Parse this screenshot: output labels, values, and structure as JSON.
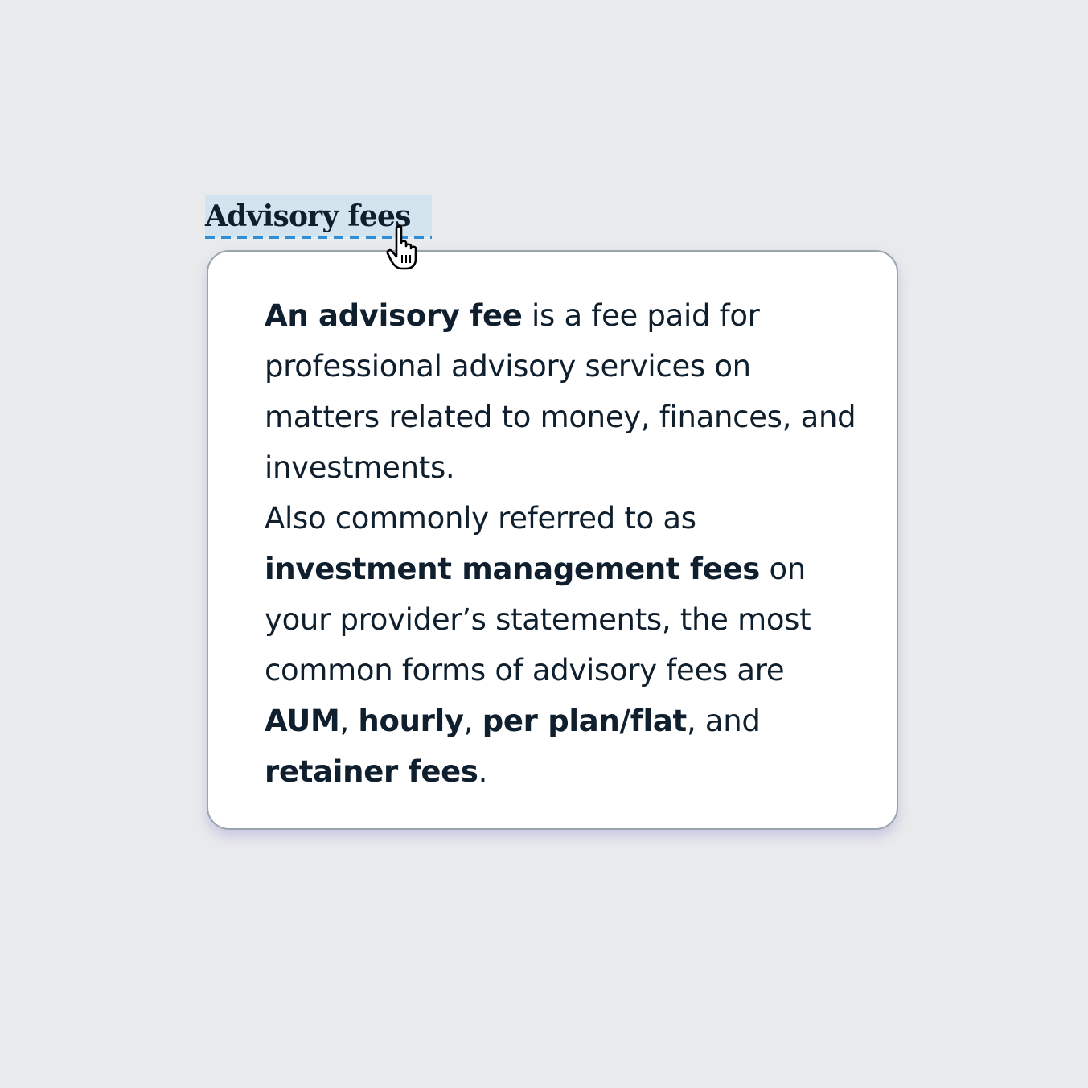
{
  "term": {
    "label": "Advisory fees"
  },
  "tooltip": {
    "paragraph1": {
      "bold_lead": "An advisory fee",
      "rest": " is a fee paid for professional advisory services on matters related to money, finances, and investments."
    },
    "paragraph2": {
      "text_a": "Also commonly referred to as ",
      "bold_b": "investment management fees",
      "text_c": " on your provider’s statements, the most common forms of advisory fees are ",
      "bold_d": "AUM",
      "text_e": ", ",
      "bold_f": "hourly",
      "text_g": ", ",
      "bold_h": "per plan/flat",
      "text_i": ", and ",
      "bold_j": "retainer fees",
      "text_k": "."
    }
  },
  "colors": {
    "background": "#e9eaec",
    "term_highlight": "#d3e4ef",
    "underline": "#2f8ed9",
    "text": "#0f1f2e",
    "tooltip_border": "#9aa4ad"
  },
  "icons": {
    "cursor": "hand-pointer-icon"
  }
}
